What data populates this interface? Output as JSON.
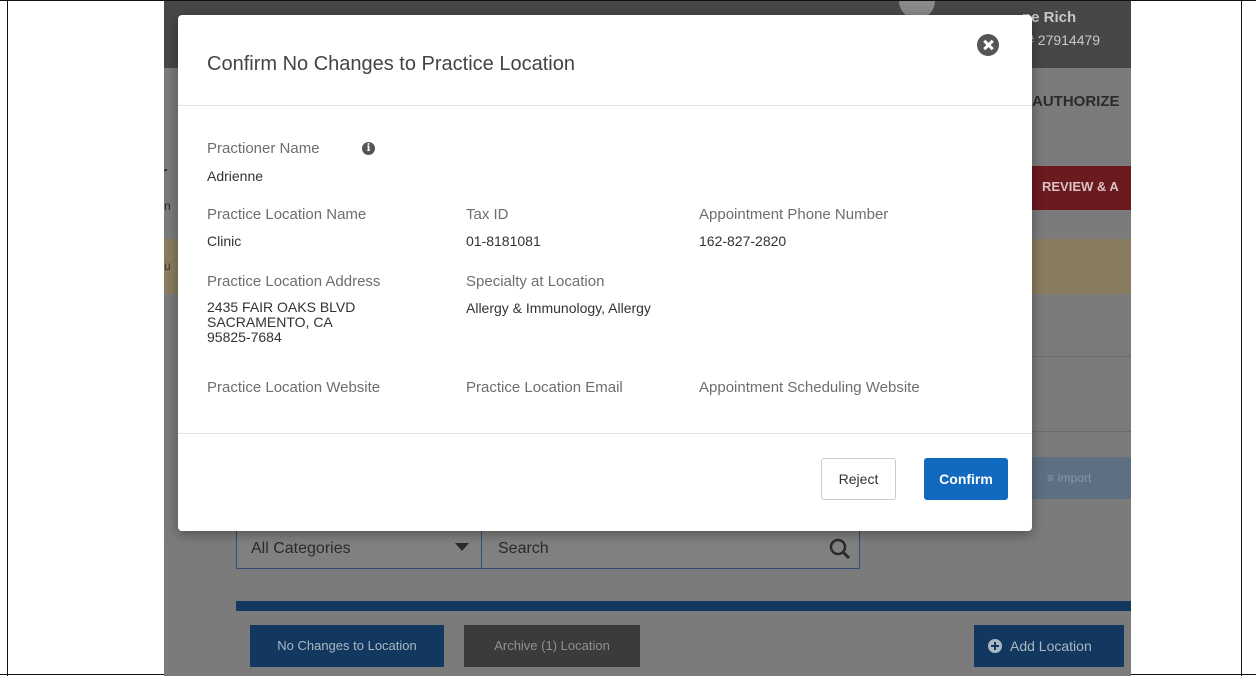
{
  "background": {
    "user": {
      "name": "ne Rich",
      "id": "D# 27914479"
    },
    "authorize_tab": "AUTHORIZE",
    "review_button": "REVIEW & A",
    "left_fragment_1": "r",
    "left_fragment_2": "n",
    "banner_fragment": "u",
    "import_button": "≡ Import",
    "category_select": {
      "value": "All Categories"
    },
    "search": {
      "placeholder": "Search"
    },
    "list_buttons": {
      "no_changes": "No Changes to Location",
      "archive": "Archive (1) Location",
      "add_location": "Add Location"
    }
  },
  "modal": {
    "title": "Confirm No Changes to Practice Location",
    "fields": {
      "practitioner_name": {
        "label": "Practioner Name",
        "value": "Adrienne"
      },
      "practice_location_name": {
        "label": "Practice Location Name",
        "value": "Clinic"
      },
      "tax_id": {
        "label": "Tax ID",
        "value": "01-8181081"
      },
      "appointment_phone": {
        "label": "Appointment Phone Number",
        "value": "162-827-2820"
      },
      "practice_location_address": {
        "label": "Practice Location Address",
        "value": "2435 FAIR OAKS BLVD\nSACRAMENTO, CA\n95825-7684"
      },
      "specialty": {
        "label": "Specialty at Location",
        "value": "Allergy & Immunology, Allergy"
      },
      "website": {
        "label": "Practice Location Website",
        "value": ""
      },
      "email": {
        "label": "Practice Location Email",
        "value": ""
      },
      "scheduling_website": {
        "label": "Appointment Scheduling Website",
        "value": ""
      }
    },
    "buttons": {
      "reject": "Reject",
      "confirm": "Confirm"
    }
  },
  "colors": {
    "confirm_blue": "#1269c0",
    "nav_dark_blue": "#12385f",
    "overlay_gray": "#7b7b7b",
    "review_red": "#6b1a20"
  }
}
